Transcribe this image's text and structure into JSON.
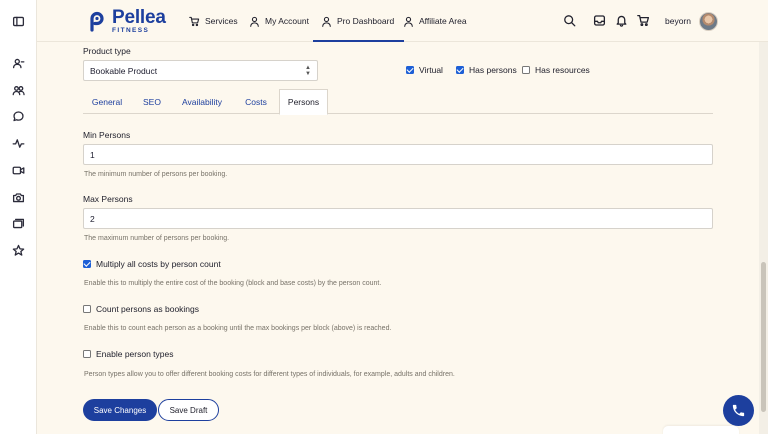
{
  "brand": {
    "name": "Pellea",
    "tagline": "FITNESS",
    "color": "#1d3f9e"
  },
  "nav": {
    "items": [
      {
        "label": "Services",
        "icon": "cart-icon"
      },
      {
        "label": "My Account",
        "icon": "user-icon"
      },
      {
        "label": "Pro Dashboard",
        "icon": "user-icon",
        "active": true
      },
      {
        "label": "Affiliate Area",
        "icon": "user-icon"
      }
    ],
    "username": "beyorn"
  },
  "rail_icons": [
    "panel-toggle-icon",
    "user-list-icon",
    "users-icon",
    "chat-icon",
    "activity-icon",
    "video-icon",
    "camera-icon",
    "media-icon",
    "star-icon"
  ],
  "product": {
    "type_label": "Product type",
    "type_value": "Bookable Product",
    "options": [
      {
        "label": "Virtual",
        "checked": true
      },
      {
        "label": "Has persons",
        "checked": true
      },
      {
        "label": "Has resources",
        "checked": false
      }
    ]
  },
  "tabs": [
    "General",
    "SEO",
    "Availability",
    "Costs",
    "Persons"
  ],
  "active_tab": "Persons",
  "persons": {
    "min_label": "Min Persons",
    "min_value": "1",
    "min_help": "The minimum number of persons per booking.",
    "max_label": "Max Persons",
    "max_value": "2",
    "max_help": "The maximum number of persons per booking.",
    "multiply": {
      "label": "Multiply all costs by person count",
      "checked": true,
      "help": "Enable this to multiply the entire cost of the booking (block and base costs) by the person count."
    },
    "count_as_bookings": {
      "label": "Count persons as bookings",
      "checked": false,
      "help": "Enable this to count each person as a booking until the max bookings per block (above) is reached."
    },
    "person_types": {
      "label": "Enable person types",
      "checked": false,
      "help": "Person types allow you to offer different booking costs for different types of individuals, for example, adults and children."
    }
  },
  "actions": {
    "save_changes": "Save Changes",
    "save_draft": "Save Draft"
  }
}
